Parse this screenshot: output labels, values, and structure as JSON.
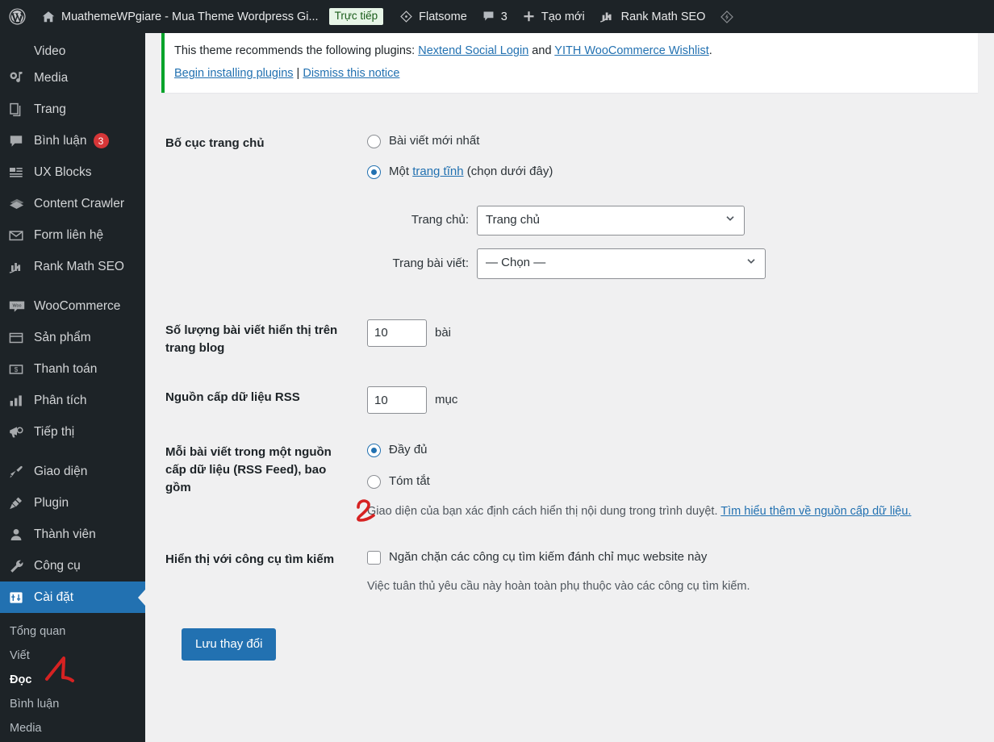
{
  "adminbar": {
    "items": [
      {
        "name": "wp-logo",
        "icon": "wordpress-icon",
        "label": ""
      },
      {
        "name": "site-name",
        "icon": "home-icon",
        "label": "MuathemeWPgiare - Mua Theme Wordpress Gi..."
      },
      {
        "name": "live-badge",
        "icon": "",
        "label": "Trực tiếp"
      },
      {
        "name": "flatsome",
        "icon": "flatsome-icon",
        "label": "Flatsome"
      },
      {
        "name": "comments",
        "icon": "comment-bubble-icon",
        "label": "3"
      },
      {
        "name": "new-content",
        "icon": "plus-icon",
        "label": "Tạo mới"
      },
      {
        "name": "rank-math",
        "icon": "rank-math-icon",
        "label": "Rank Math SEO"
      },
      {
        "name": "diamond",
        "icon": "diamond-icon",
        "label": ""
      }
    ]
  },
  "sidebar": {
    "items": [
      {
        "label": "Video",
        "icon": "video-icon",
        "badge": "",
        "active": false,
        "cut": true
      },
      {
        "label": "Media",
        "icon": "media-icon",
        "badge": "",
        "active": false
      },
      {
        "label": "Trang",
        "icon": "pages-icon",
        "badge": "",
        "active": false
      },
      {
        "label": "Bình luận",
        "icon": "comment-icon",
        "badge": "3",
        "active": false
      },
      {
        "label": "UX Blocks",
        "icon": "blocks-icon",
        "badge": "",
        "active": false
      },
      {
        "label": "Content Crawler",
        "icon": "crawler-icon",
        "badge": "",
        "active": false
      },
      {
        "label": "Form liên hệ",
        "icon": "mail-icon",
        "badge": "",
        "active": false
      },
      {
        "label": "Rank Math SEO",
        "icon": "rank-math-icon",
        "badge": "",
        "active": false
      },
      {
        "label": "WooCommerce",
        "icon": "woo-icon",
        "badge": "",
        "active": false,
        "sep_before": true
      },
      {
        "label": "Sản phẩm",
        "icon": "products-icon",
        "badge": "",
        "active": false
      },
      {
        "label": "Thanh toán",
        "icon": "payments-icon",
        "badge": "",
        "active": false
      },
      {
        "label": "Phân tích",
        "icon": "analytics-icon",
        "badge": "",
        "active": false
      },
      {
        "label": "Tiếp thị",
        "icon": "marketing-icon",
        "badge": "",
        "active": false
      },
      {
        "label": "Giao diện",
        "icon": "appearance-icon",
        "badge": "",
        "active": false,
        "sep_before": true
      },
      {
        "label": "Plugin",
        "icon": "plugin-icon",
        "badge": "",
        "active": false
      },
      {
        "label": "Thành viên",
        "icon": "users-icon",
        "badge": "",
        "active": false
      },
      {
        "label": "Công cụ",
        "icon": "tools-icon",
        "badge": "",
        "active": false
      },
      {
        "label": "Cài đặt",
        "icon": "settings-icon",
        "badge": "",
        "active": true
      }
    ],
    "submenu": [
      {
        "label": "Tổng quan",
        "current": false
      },
      {
        "label": "Viết",
        "current": false
      },
      {
        "label": "Đọc",
        "current": true
      },
      {
        "label": "Bình luận",
        "current": false
      },
      {
        "label": "Media",
        "current": false
      }
    ]
  },
  "notice": {
    "text_before": "This theme recommends the following plugins: ",
    "link1": "Nextend Social Login",
    "text_and": " and ",
    "link2": "YITH WooCommerce Wishlist",
    "text_after": ".",
    "action_install": "Begin installing plugins",
    "separator": "|",
    "action_dismiss": "Dismiss this notice",
    "accent_color": "#00a32a"
  },
  "form": {
    "homepage": {
      "label": "Bố cục trang chủ",
      "option_latest": "Bài viết mới nhất",
      "option_static_prefix": "Một ",
      "option_static_link": "trang tĩnh",
      "option_static_suffix": " (chọn dưới đây)",
      "selected": "static",
      "front_label": "Trang chủ:",
      "front_value": "Trang chủ",
      "front_options": [
        "— Chọn —",
        "Trang chủ"
      ],
      "posts_label": "Trang bài viết:",
      "posts_value": "— Chọn —",
      "posts_options": [
        "— Chọn —",
        "Trang chủ"
      ]
    },
    "posts_per_page": {
      "label": "Số lượng bài viết hiển thị trên trang blog",
      "value": "10",
      "unit": "bài"
    },
    "rss_items": {
      "label": "Nguồn cấp dữ liệu RSS",
      "value": "10",
      "unit": "mục"
    },
    "feed_content": {
      "label": "Mỗi bài viết trong một nguồn cấp dữ liệu (RSS Feed), bao gồm",
      "option_full": "Đầy đủ",
      "option_summary": "Tóm tắt",
      "selected": "full",
      "description_text": "Giao diện của bạn xác định cách hiển thị nội dung trong trình duyệt. ",
      "description_link": "Tìm hiểu thêm về nguồn cấp dữ liệu."
    },
    "search_visibility": {
      "label": "Hiển thị với công cụ tìm kiếm",
      "checkbox_label": "Ngăn chặn các công cụ tìm kiếm đánh chỉ mục website này",
      "checked": false,
      "description": "Việc tuân thủ yêu cầu này hoàn toàn phụ thuộc vào các công cụ tìm kiếm."
    },
    "submit_label": "Lưu thay đổi"
  },
  "annotations": [
    {
      "name": "annotation-1",
      "text": "1",
      "color": "#d62222"
    },
    {
      "name": "annotation-2",
      "text": "2",
      "color": "#d62222"
    }
  ],
  "colors": {
    "admin_dark": "#1d2327",
    "accent_blue": "#2271b1",
    "page_bg": "#f0f0f1",
    "badge_red": "#d63638",
    "notice_green": "#00a32a"
  }
}
